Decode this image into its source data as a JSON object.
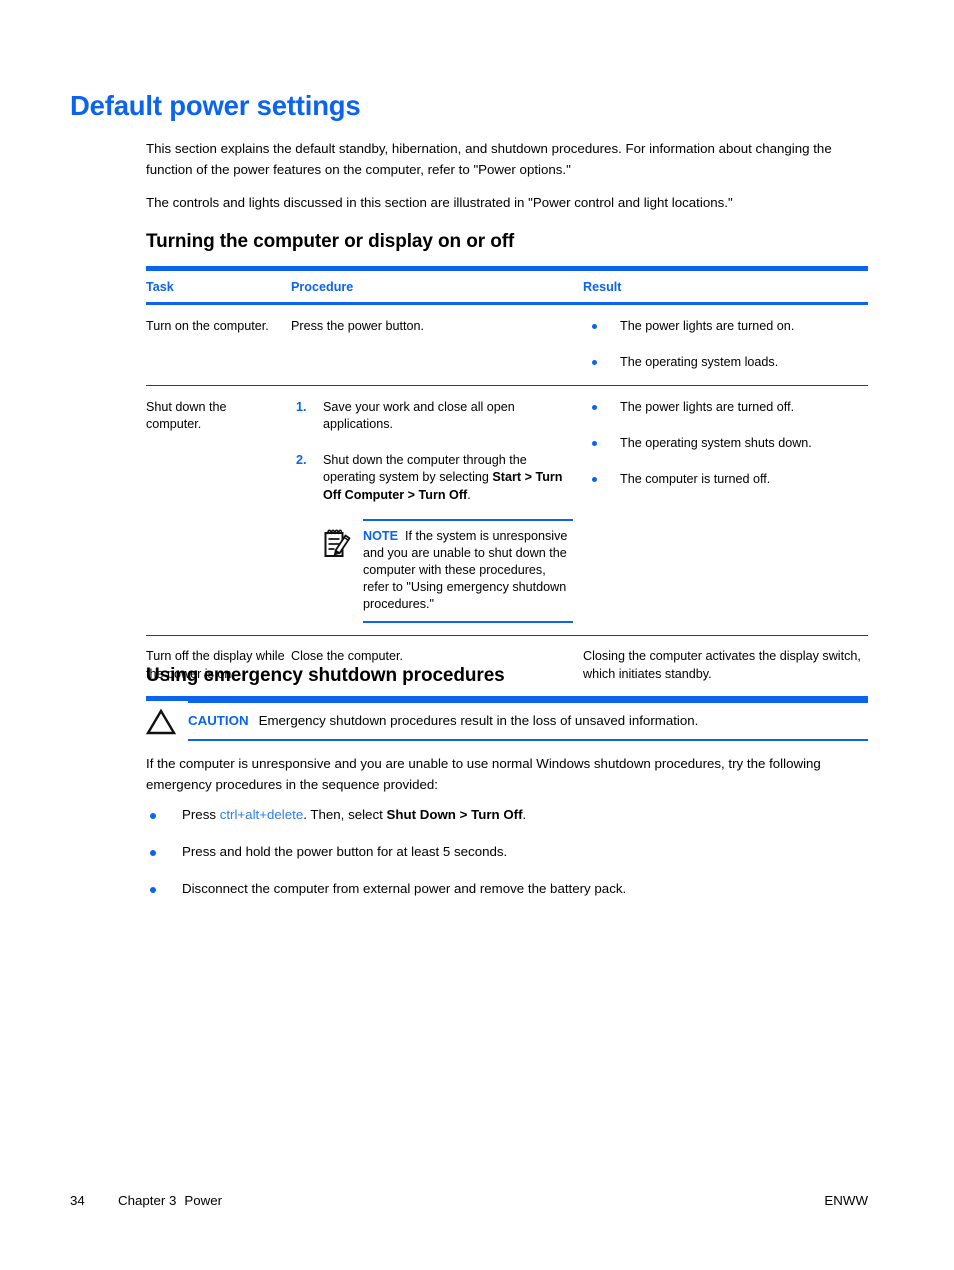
{
  "page": {
    "heading": "Default power settings",
    "intro_1": "This section explains the default standby, hibernation, and shutdown procedures. For information about changing the function of the power features on the computer, refer to \"Power options.\"",
    "intro_2": "The controls and lights discussed in this section are illustrated in \"Power control and light locations.\""
  },
  "section_turning": {
    "heading": "Turning the computer or display on or off",
    "table": {
      "headers": [
        "Task",
        "Procedure",
        "Result"
      ],
      "rows": [
        {
          "task": "Turn on the computer.",
          "procedure_text": "Press the power button.",
          "results": [
            "The power lights are turned on.",
            "The operating system loads."
          ]
        },
        {
          "task": "Shut down the computer.",
          "steps": [
            {
              "number": "1.",
              "text": "Save your work and close all open applications."
            },
            {
              "number": "2.",
              "text_before": "Shut down the computer through the operating system by selecting ",
              "bold": "Start > Turn Off Computer > Turn Off",
              "text_after": "."
            }
          ],
          "note": {
            "icon": "note-pad-pencil-icon",
            "keyword": "NOTE",
            "text": "If the system is unresponsive and you are unable to shut down the computer with these procedures, refer to \"Using emergency shutdown procedures.\""
          },
          "results": [
            "The power lights are turned off.",
            "The operating system shuts down.",
            "The computer is turned off."
          ]
        },
        {
          "task": "Turn off the display while the power is on.",
          "procedure_text": "Close the computer.",
          "result_text": "Closing the computer activates the display switch, which initiates standby."
        }
      ]
    }
  },
  "section_emergency": {
    "heading": "Using emergency shutdown procedures",
    "caution": {
      "icon": "warning-triangle-icon",
      "keyword": "CAUTION",
      "text": "Emergency shutdown procedures result in the loss of unsaved information."
    },
    "intro": "If the computer is unresponsive and you are unable to use normal Windows shutdown procedures, try the following emergency procedures in the sequence provided:",
    "bullets": [
      {
        "prefix": "Press ",
        "link": "ctrl+alt+delete",
        "middle": ". Then, select ",
        "bold": "Shut Down > Turn Off",
        "suffix": "."
      },
      {
        "plain": "Press and hold the power button for at least 5 seconds."
      },
      {
        "plain": "Disconnect the computer from external power and remove the battery pack."
      }
    ]
  },
  "footer": {
    "page_number": "34",
    "chapter": "Chapter 3",
    "chapter_title": "Power",
    "locale": "ENWW"
  },
  "colors": {
    "accent_blue": "#0a64f0",
    "link_blue": "#2b7ef0",
    "text": "#000000",
    "rule_gray": "#3c3c3c"
  }
}
